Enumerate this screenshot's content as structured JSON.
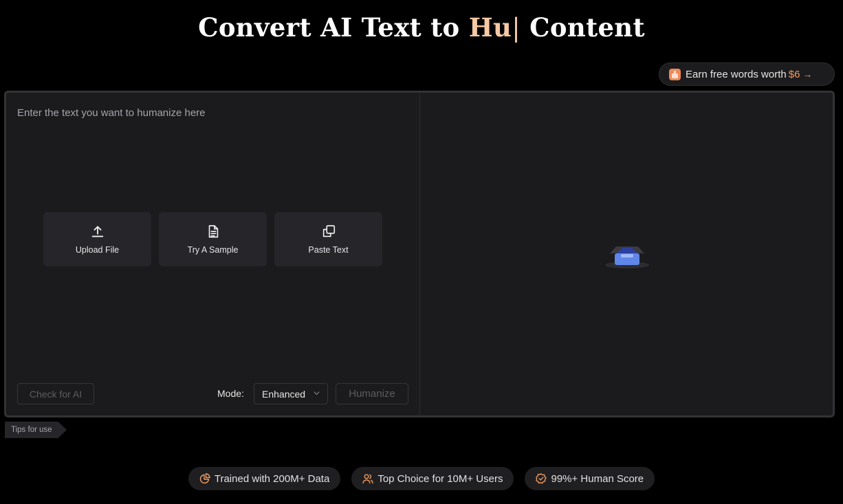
{
  "header": {
    "title_prefix": "Convert AI Text to ",
    "title_highlight": "Hu",
    "title_cursor": "|",
    "title_suffix": " Content"
  },
  "promo": {
    "label": "Earn free words worth",
    "amount": "$6",
    "arrow": "→"
  },
  "editor": {
    "placeholder": "Enter the text you want to humanize here",
    "actions": [
      {
        "label": "Upload File",
        "icon": "upload-icon"
      },
      {
        "label": "Try A Sample",
        "icon": "document-icon"
      },
      {
        "label": "Paste Text",
        "icon": "copy-icon"
      }
    ],
    "check_label": "Check for AI",
    "mode_label": "Mode:",
    "mode_value": "Enhanced",
    "humanize_label": "Humanize"
  },
  "tips": {
    "label": "Tips for use"
  },
  "features": [
    {
      "label": "Trained with 200M+ Data",
      "icon": "pie-chart-icon"
    },
    {
      "label": "Top Choice for 10M+ Users",
      "icon": "users-icon"
    },
    {
      "label": "99%+ Human Score",
      "icon": "verified-badge-icon"
    }
  ],
  "colors": {
    "accent": "#f39b5f",
    "highlight": "#f5c9a4",
    "panel": "#1b1b1d"
  }
}
